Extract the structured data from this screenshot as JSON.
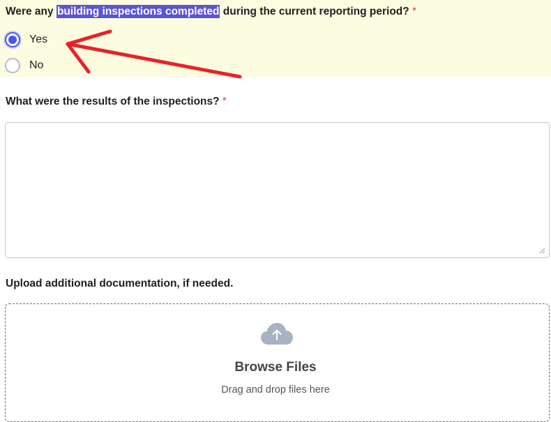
{
  "question1": {
    "title_before": "Were any ",
    "title_highlight": "building inspections completed",
    "title_after": " during the current reporting period?",
    "required_mark": "*",
    "options": [
      {
        "label": "Yes",
        "checked": true
      },
      {
        "label": "No",
        "checked": false
      }
    ]
  },
  "question2": {
    "title": "What were the results of the inspections?",
    "required_mark": "*",
    "value": ""
  },
  "question3": {
    "title": "Upload additional documentation, if needed."
  },
  "upload": {
    "icon": "cloud-upload-icon",
    "browse_label": "Browse Files",
    "hint": "Drag and drop files here"
  },
  "colors": {
    "question_highlight_bg": "#fbfce0",
    "text_selection": "#5b54d4",
    "radio_accent": "#4a56ea",
    "required": "#d64545",
    "annotation_arrow": "#e8222a"
  }
}
